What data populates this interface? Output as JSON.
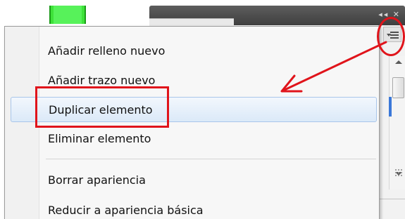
{
  "panel": {
    "header_controls": "◂◂ ✕",
    "menu_button_icon": "panel-menu-icon"
  },
  "menu": {
    "items": [
      {
        "label": "Añadir relleno nuevo"
      },
      {
        "label": "Añadir trazo nuevo"
      },
      {
        "label": "Duplicar elemento",
        "highlighted": true
      },
      {
        "label": "Eliminar elemento"
      },
      {
        "label": "Borrar apariencia"
      },
      {
        "label": "Reducir a apariencia básica"
      }
    ]
  },
  "annotations": {
    "color": "#e0141b"
  }
}
